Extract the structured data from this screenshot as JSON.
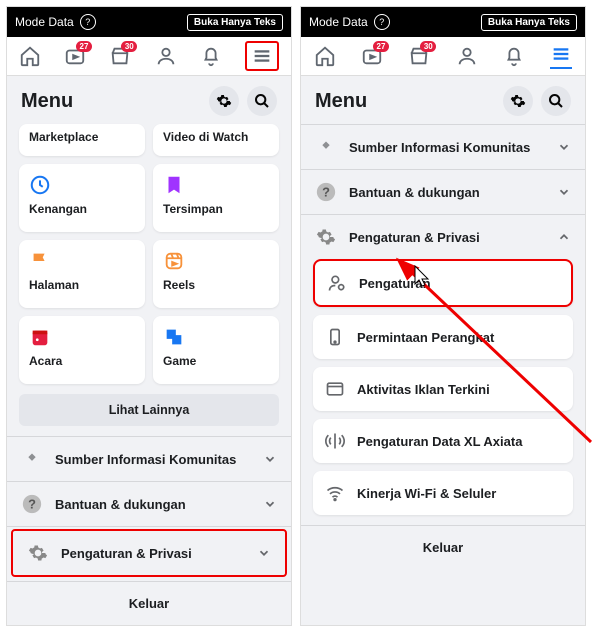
{
  "statusbar": {
    "mode_label": "Mode Data",
    "text_only_button": "Buka Hanya Teks"
  },
  "tabs": {
    "badge_friends": "27",
    "badge_market": "30"
  },
  "menu": {
    "title": "Menu",
    "see_more": "Lihat Lainnya",
    "logout": "Keluar"
  },
  "tiles": {
    "marketplace": "Marketplace",
    "video": "Video di Watch",
    "memories": "Kenangan",
    "saved": "Tersimpan",
    "pages": "Halaman",
    "reels": "Reels",
    "events": "Acara",
    "gaming": "Game"
  },
  "accordions": {
    "community": "Sumber Informasi Komunitas",
    "help": "Bantuan & dukungan",
    "settings_privacy": "Pengaturan & Privasi"
  },
  "subitems": {
    "settings": "Pengaturan",
    "device_requests": "Permintaan Perangkat",
    "recent_ads": "Aktivitas Iklan Terkini",
    "xl_data": "Pengaturan Data XL Axiata",
    "wifi_perf": "Kinerja Wi-Fi & Seluler"
  }
}
